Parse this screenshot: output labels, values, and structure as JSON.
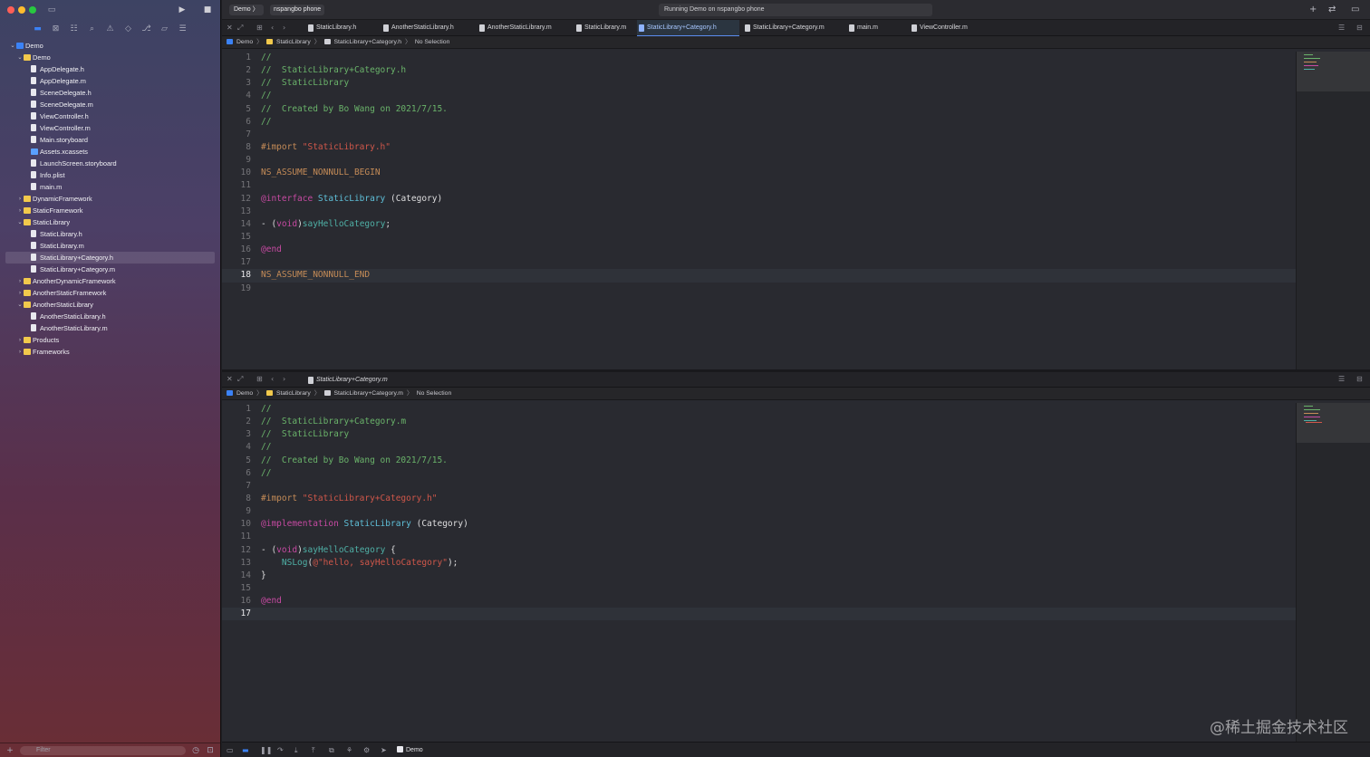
{
  "toolbar": {
    "scheme": "Demo",
    "device": "nspangbo phone",
    "status": "Running Demo on nspangbo phone"
  },
  "navigator": {
    "filter_placeholder": "Filter",
    "tree": [
      {
        "label": "Demo",
        "depth": 0,
        "kind": "proj",
        "open": true
      },
      {
        "label": "Demo",
        "depth": 1,
        "kind": "folder",
        "open": true
      },
      {
        "label": "AppDelegate.h",
        "depth": 2,
        "kind": "file"
      },
      {
        "label": "AppDelegate.m",
        "depth": 2,
        "kind": "file"
      },
      {
        "label": "SceneDelegate.h",
        "depth": 2,
        "kind": "file"
      },
      {
        "label": "SceneDelegate.m",
        "depth": 2,
        "kind": "file"
      },
      {
        "label": "ViewController.h",
        "depth": 2,
        "kind": "file"
      },
      {
        "label": "ViewController.m",
        "depth": 2,
        "kind": "file"
      },
      {
        "label": "Main.storyboard",
        "depth": 2,
        "kind": "file"
      },
      {
        "label": "Assets.xcassets",
        "depth": 2,
        "kind": "asset"
      },
      {
        "label": "LaunchScreen.storyboard",
        "depth": 2,
        "kind": "file"
      },
      {
        "label": "Info.plist",
        "depth": 2,
        "kind": "file"
      },
      {
        "label": "main.m",
        "depth": 2,
        "kind": "file"
      },
      {
        "label": "DynamicFramework",
        "depth": 1,
        "kind": "folder",
        "open": false
      },
      {
        "label": "StaticFramework",
        "depth": 1,
        "kind": "folder",
        "open": false
      },
      {
        "label": "StaticLibrary",
        "depth": 1,
        "kind": "folder",
        "open": true
      },
      {
        "label": "StaticLibrary.h",
        "depth": 2,
        "kind": "file"
      },
      {
        "label": "StaticLibrary.m",
        "depth": 2,
        "kind": "file"
      },
      {
        "label": "StaticLibrary+Category.h",
        "depth": 2,
        "kind": "file",
        "selected": true
      },
      {
        "label": "StaticLibrary+Category.m",
        "depth": 2,
        "kind": "file"
      },
      {
        "label": "AnotherDynamicFramework",
        "depth": 1,
        "kind": "folder",
        "open": false
      },
      {
        "label": "AnotherStaticFramework",
        "depth": 1,
        "kind": "folder",
        "open": false
      },
      {
        "label": "AnotherStaticLibrary",
        "depth": 1,
        "kind": "folder",
        "open": true
      },
      {
        "label": "AnotherStaticLibrary.h",
        "depth": 2,
        "kind": "file"
      },
      {
        "label": "AnotherStaticLibrary.m",
        "depth": 2,
        "kind": "file"
      },
      {
        "label": "Products",
        "depth": 1,
        "kind": "folder",
        "open": false
      },
      {
        "label": "Frameworks",
        "depth": 1,
        "kind": "folder",
        "open": false
      }
    ]
  },
  "tabs": [
    {
      "label": "StaticLibrary.h",
      "active": false
    },
    {
      "label": "AnotherStaticLibrary.h",
      "active": false
    },
    {
      "label": "AnotherStaticLibrary.m",
      "active": false
    },
    {
      "label": "StaticLibrary.m",
      "active": false
    },
    {
      "label": "StaticLibrary+Category.h",
      "active": true
    },
    {
      "label": "StaticLibrary+Category.m",
      "active": false
    },
    {
      "label": "main.m",
      "active": false
    },
    {
      "label": "ViewController.m",
      "active": false
    }
  ],
  "pane1": {
    "breadcrumb": [
      "Demo",
      "StaticLibrary",
      "StaticLibrary+Category.h",
      "No Selection"
    ],
    "current_line": 18,
    "lines": [
      [
        [
          "com",
          "//"
        ]
      ],
      [
        [
          "com",
          "//  StaticLibrary+Category.h"
        ]
      ],
      [
        [
          "com",
          "//  StaticLibrary"
        ]
      ],
      [
        [
          "com",
          "//"
        ]
      ],
      [
        [
          "com",
          "//  Created by Bo Wang on 2021/7/15."
        ]
      ],
      [
        [
          "com",
          "//"
        ]
      ],
      [],
      [
        [
          "pre",
          "#import "
        ],
        [
          "str",
          "\"StaticLibrary.h\""
        ]
      ],
      [],
      [
        [
          "pre",
          "NS_ASSUME_NONNULL_BEGIN"
        ]
      ],
      [],
      [
        [
          "key",
          "@interface "
        ],
        [
          "cls",
          "StaticLibrary "
        ],
        [
          "pl",
          "(Category)"
        ]
      ],
      [],
      [
        [
          "pl",
          "- ("
        ],
        [
          "key",
          "void"
        ],
        [
          "pl",
          ")"
        ],
        [
          "fn",
          "sayHelloCategory"
        ],
        [
          "pl",
          ";"
        ]
      ],
      [],
      [
        [
          "key",
          "@end"
        ]
      ],
      [],
      [
        [
          "pre",
          "NS_ASSUME_NONNULL_END"
        ]
      ],
      []
    ]
  },
  "pane2": {
    "title": "StaticLibrary+Category.m",
    "breadcrumb": [
      "Demo",
      "StaticLibrary",
      "StaticLibrary+Category.m",
      "No Selection"
    ],
    "current_line": 17,
    "lines": [
      [
        [
          "com",
          "//"
        ]
      ],
      [
        [
          "com",
          "//  StaticLibrary+Category.m"
        ]
      ],
      [
        [
          "com",
          "//  StaticLibrary"
        ]
      ],
      [
        [
          "com",
          "//"
        ]
      ],
      [
        [
          "com",
          "//  Created by Bo Wang on 2021/7/15."
        ]
      ],
      [
        [
          "com",
          "//"
        ]
      ],
      [],
      [
        [
          "pre",
          "#import "
        ],
        [
          "str",
          "\"StaticLibrary+Category.h\""
        ]
      ],
      [],
      [
        [
          "key",
          "@implementation "
        ],
        [
          "cls",
          "StaticLibrary "
        ],
        [
          "pl",
          "(Category)"
        ]
      ],
      [],
      [
        [
          "pl",
          "- ("
        ],
        [
          "key",
          "void"
        ],
        [
          "pl",
          ")"
        ],
        [
          "fn",
          "sayHelloCategory"
        ],
        [
          "pl",
          " {"
        ]
      ],
      [
        [
          "pl",
          "    "
        ],
        [
          "fn",
          "NSLog"
        ],
        [
          "pl",
          "("
        ],
        [
          "str",
          "@\"hello, sayHelloCategory\""
        ],
        [
          "pl",
          ");"
        ]
      ],
      [
        [
          "pl",
          "}"
        ]
      ],
      [],
      [
        [
          "key",
          "@end"
        ]
      ],
      []
    ]
  },
  "debugbar": {
    "target": "Demo"
  },
  "watermark": "@稀土掘金技术社区",
  "colors": {
    "accent": "#3b82f6",
    "comment": "#6ab36a",
    "preprocessor": "#c48b57",
    "string": "#d0574a",
    "keyword": "#c64aa2",
    "class": "#5fc0d9"
  }
}
